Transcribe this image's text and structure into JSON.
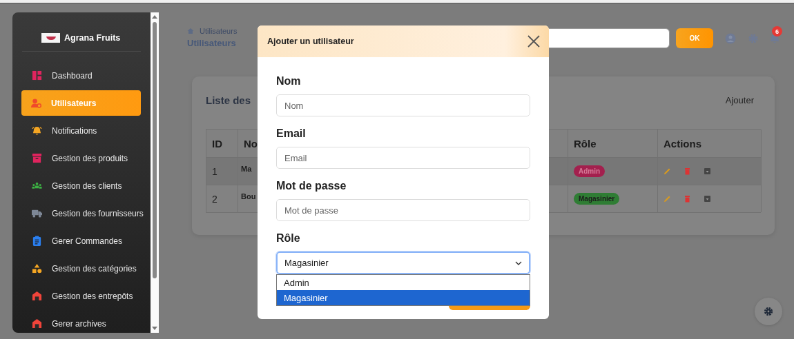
{
  "sidebar": {
    "brand": "Agrana Fruits",
    "items": [
      {
        "label": "Dashboard",
        "selected": false
      },
      {
        "label": "Utilisateurs",
        "selected": true
      },
      {
        "label": "Notifications",
        "selected": false
      },
      {
        "label": "Gestion des produits",
        "selected": false
      },
      {
        "label": "Gestion des clients",
        "selected": false
      },
      {
        "label": "Gestion des fournisseurs",
        "selected": false
      },
      {
        "label": "Gerer Commandes",
        "selected": false
      },
      {
        "label": "Gestion des catégories",
        "selected": false
      },
      {
        "label": "Gestion des entrepôts",
        "selected": false
      },
      {
        "label": "Gerer archives",
        "selected": false
      }
    ]
  },
  "header": {
    "breadcrumb": "Utilisateurs",
    "title": "Utilisateurs",
    "ok_button": "OK",
    "notification_count": "6"
  },
  "card": {
    "title": "Liste des",
    "add_link": "Ajouter",
    "table": {
      "columns": [
        "ID",
        "No",
        "Rôle",
        "Actions"
      ],
      "rows": [
        {
          "id": "1",
          "column_2": "Ma",
          "role": "Admin",
          "color": "#a3204e"
        },
        {
          "id": "2",
          "column_2": "Bou",
          "role": "Magasinier",
          "color": "#2f7d34"
        }
      ]
    }
  },
  "modal": {
    "title": "Ajouter un utilisateur",
    "fields": [
      {
        "kind": "text",
        "label": "Nom",
        "placeholder": "Nom"
      },
      {
        "kind": "text",
        "label": "Email",
        "placeholder": "Email"
      },
      {
        "kind": "text",
        "label": "Mot de passe",
        "placeholder": "Mot de passe"
      },
      {
        "kind": "select",
        "label": "Rôle",
        "value": "Magasinier",
        "expanded": true,
        "options": [
          {
            "label": "Admin",
            "selected": false
          },
          {
            "label": "Magasinier",
            "selected": true
          }
        ]
      }
    ]
  }
}
